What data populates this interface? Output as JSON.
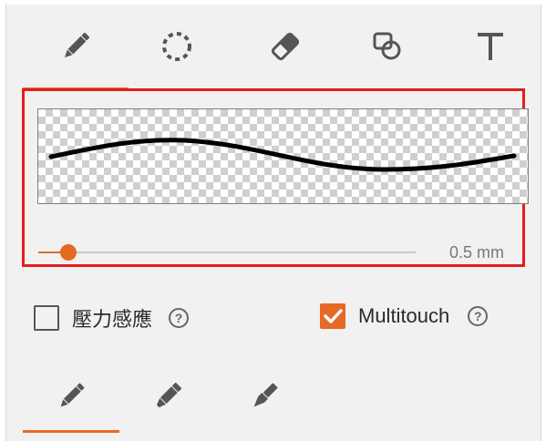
{
  "colors": {
    "accent": "#e46a25",
    "highlight_border": "#e51d1d",
    "icon": "#555555"
  },
  "tools": [
    {
      "icon": "pencil-icon",
      "active": true
    },
    {
      "icon": "lasso-icon",
      "active": false
    },
    {
      "icon": "eraser-icon",
      "active": false
    },
    {
      "icon": "shapes-icon",
      "active": false
    },
    {
      "icon": "text-icon",
      "active": false
    }
  ],
  "stroke_preview": {
    "background": "transparency-checkerboard"
  },
  "stroke_size": {
    "value_label": "0.5 mm",
    "slider_fraction": 0.08
  },
  "options": {
    "pressure": {
      "label": "壓力感應",
      "checked": false,
      "help_icon": "help-icon",
      "help_glyph": "?"
    },
    "multitouch": {
      "label": "Multitouch",
      "checked": true,
      "help_icon": "help-icon",
      "help_glyph": "?"
    }
  },
  "brushes": [
    {
      "icon": "pen-icon",
      "active": true
    },
    {
      "icon": "marker-icon",
      "active": false
    },
    {
      "icon": "fountain-pen-icon",
      "active": false
    }
  ]
}
